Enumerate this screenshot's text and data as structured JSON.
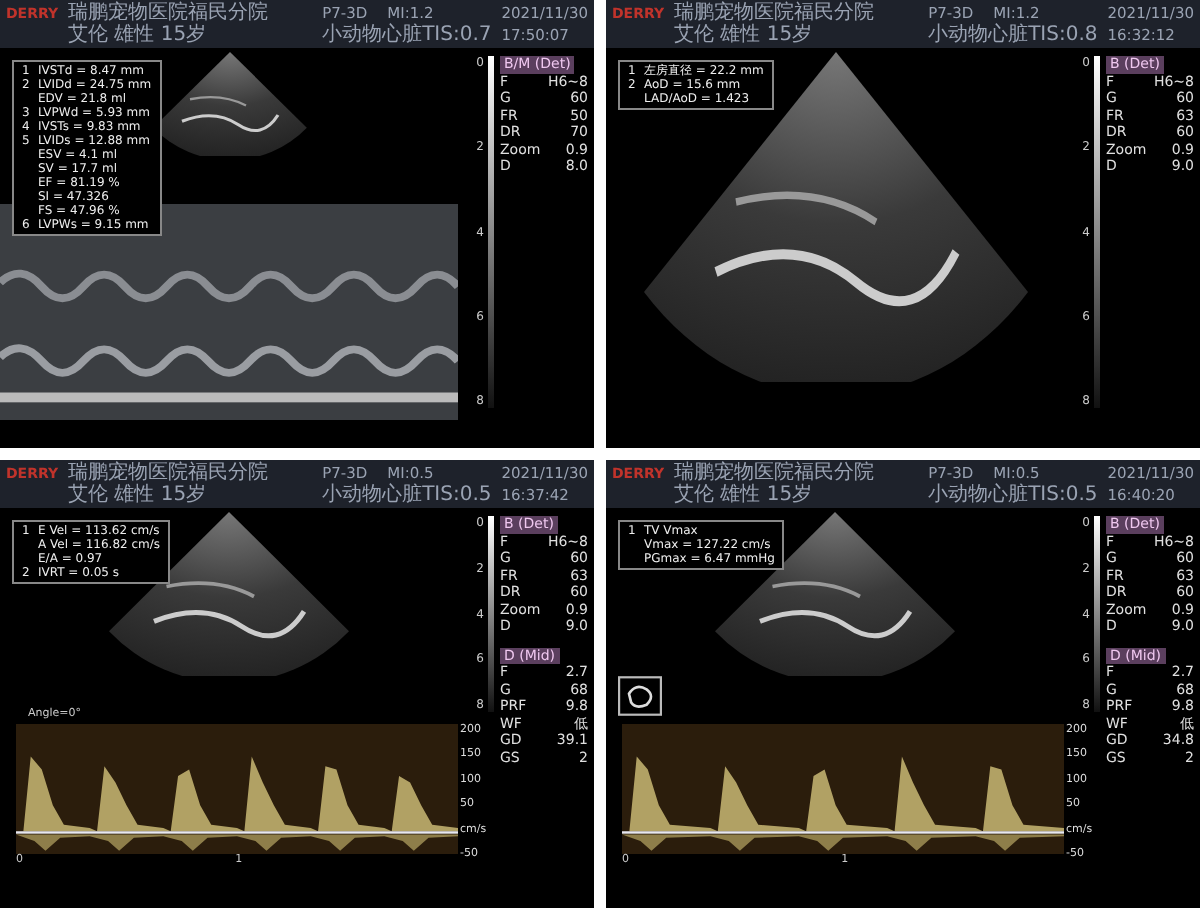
{
  "panels": [
    {
      "kind": "m_mode",
      "header": {
        "logo": "DERRY",
        "hospital": "瑞鹏宠物医院福民分院",
        "patient": "艾伦 雄性 15岁",
        "probe": "P7-3D",
        "mi": "MI:1.2",
        "preset": "小动物心脏TIS:0.7",
        "date": "2021/11/30",
        "time": "17:50:07"
      },
      "measurements": [
        {
          "index": "1",
          "text": "IVSTd = 8.47 mm"
        },
        {
          "index": "2",
          "text": "LVIDd = 24.75 mm"
        },
        {
          "text": "EDV = 21.8 ml"
        },
        {
          "index": "3",
          "text": "LVPWd = 5.93 mm"
        },
        {
          "index": "4",
          "text": "IVSTs = 9.83 mm"
        },
        {
          "index": "5",
          "text": "LVIDs = 12.88 mm"
        },
        {
          "text": "ESV = 4.1 ml"
        },
        {
          "text": "SV = 17.7 ml"
        },
        {
          "text": "EF = 81.19 %"
        },
        {
          "text": "SI = 47.326"
        },
        {
          "text": "FS = 47.96 %"
        },
        {
          "index": "6",
          "text": "LVPWs = 9.15 mm"
        }
      ],
      "depth_scale": [
        "0",
        "2",
        "4",
        "6",
        "8"
      ],
      "param_groups": [
        {
          "title": "B/M (Det)",
          "params": [
            {
              "name": "F",
              "value": "H6~8"
            },
            {
              "name": "G",
              "value": "60"
            },
            {
              "name": "FR",
              "value": "50"
            },
            {
              "name": "DR",
              "value": "70"
            },
            {
              "name": "Zoom",
              "value": "0.9"
            },
            {
              "name": "D",
              "value": "8.0"
            }
          ]
        }
      ]
    },
    {
      "kind": "b_mode",
      "header": {
        "logo": "DERRY",
        "hospital": "瑞鹏宠物医院福民分院",
        "patient": "艾伦 雄性 15岁",
        "probe": "P7-3D",
        "mi": "MI:1.2",
        "preset": "小动物心脏TIS:0.8",
        "date": "2021/11/30",
        "time": "16:32:12"
      },
      "measurements": [
        {
          "index": "1",
          "text": "左房直径 = 22.2 mm"
        },
        {
          "index": "2",
          "text": "AoD = 15.6 mm"
        },
        {
          "text": "LAD/AoD = 1.423"
        }
      ],
      "depth_scale": [
        "0",
        "2",
        "4",
        "6",
        "8"
      ],
      "param_groups": [
        {
          "title": "B (Det)",
          "params": [
            {
              "name": "F",
              "value": "H6~8"
            },
            {
              "name": "G",
              "value": "60"
            },
            {
              "name": "FR",
              "value": "63"
            },
            {
              "name": "DR",
              "value": "60"
            },
            {
              "name": "Zoom",
              "value": "0.9"
            },
            {
              "name": "D",
              "value": "9.0"
            }
          ]
        }
      ]
    },
    {
      "kind": "doppler",
      "header": {
        "logo": "DERRY",
        "hospital": "瑞鹏宠物医院福民分院",
        "patient": "艾伦 雄性 15岁",
        "probe": "P7-3D",
        "mi": "MI:0.5",
        "preset": "小动物心脏TIS:0.5",
        "date": "2021/11/30",
        "time": "16:37:42"
      },
      "measurements": [
        {
          "index": "1",
          "text": "E Vel = 113.62 cm/s"
        },
        {
          "text": "A Vel = 116.82 cm/s"
        },
        {
          "text": "E/A = 0.97"
        },
        {
          "index": "2",
          "text": "IVRT = 0.05 s"
        }
      ],
      "angle_label": "Angle=0°",
      "depth_scale": [
        "0",
        "2",
        "4",
        "6",
        "8"
      ],
      "velocity_scale": [
        "200",
        "150",
        "100",
        "50",
        "cm/s",
        "-50"
      ],
      "time_ticks": [
        "0",
        "1"
      ],
      "param_groups": [
        {
          "title": "B (Det)",
          "params": [
            {
              "name": "F",
              "value": "H6~8"
            },
            {
              "name": "G",
              "value": "60"
            },
            {
              "name": "FR",
              "value": "63"
            },
            {
              "name": "DR",
              "value": "60"
            },
            {
              "name": "Zoom",
              "value": "0.9"
            },
            {
              "name": "D",
              "value": "9.0"
            }
          ]
        },
        {
          "title": "D (Mid)",
          "params": [
            {
              "name": "F",
              "value": "2.7"
            },
            {
              "name": "G",
              "value": "68"
            },
            {
              "name": "PRF",
              "value": "9.8"
            },
            {
              "name": "WF",
              "value": "低"
            },
            {
              "name": "GD",
              "value": "39.1"
            },
            {
              "name": "GS",
              "value": "2"
            }
          ]
        }
      ]
    },
    {
      "kind": "doppler",
      "header": {
        "logo": "DERRY",
        "hospital": "瑞鹏宠物医院福民分院",
        "patient": "艾伦 雄性 15岁",
        "probe": "P7-3D",
        "mi": "MI:0.5",
        "preset": "小动物心脏TIS:0.5",
        "date": "2021/11/30",
        "time": "16:40:20"
      },
      "measurements": [
        {
          "index": "1",
          "text": "TV Vmax"
        },
        {
          "text": "Vmax = 127.22 cm/s"
        },
        {
          "text": "PGmax = 6.47 mmHg"
        }
      ],
      "orientation_marker": true,
      "depth_scale": [
        "0",
        "2",
        "4",
        "6",
        "8"
      ],
      "velocity_scale": [
        "200",
        "150",
        "100",
        "50",
        "cm/s",
        "-50"
      ],
      "time_ticks": [
        "0",
        "1"
      ],
      "param_groups": [
        {
          "title": "B (Det)",
          "params": [
            {
              "name": "F",
              "value": "H6~8"
            },
            {
              "name": "G",
              "value": "60"
            },
            {
              "name": "FR",
              "value": "63"
            },
            {
              "name": "DR",
              "value": "60"
            },
            {
              "name": "Zoom",
              "value": "0.9"
            },
            {
              "name": "D",
              "value": "9.0"
            }
          ]
        },
        {
          "title": "D (Mid)",
          "params": [
            {
              "name": "F",
              "value": "2.7"
            },
            {
              "name": "G",
              "value": "68"
            },
            {
              "name": "PRF",
              "value": "9.8"
            },
            {
              "name": "WF",
              "value": "低"
            },
            {
              "name": "GD",
              "value": "34.8"
            },
            {
              "name": "GS",
              "value": "2"
            }
          ]
        }
      ]
    }
  ]
}
